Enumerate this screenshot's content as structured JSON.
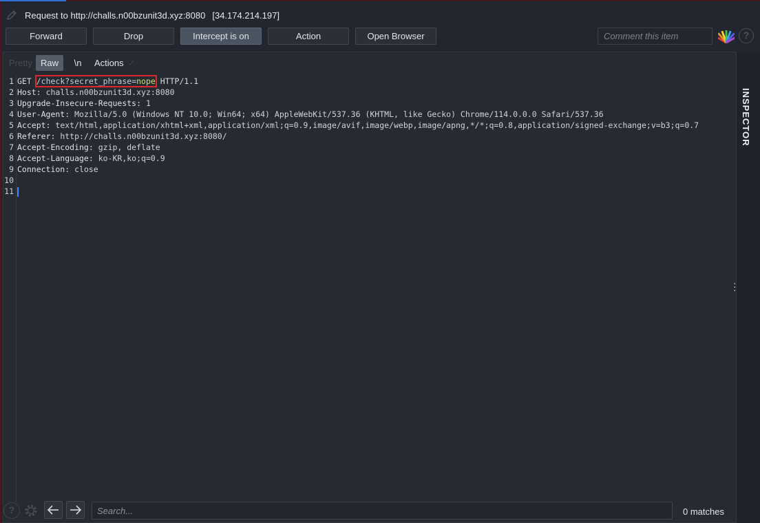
{
  "window": {
    "title_prefix": "Request to",
    "url": "http://challs.n00bzunit3d.xyz:8080",
    "ip": "[34.174.214.197]"
  },
  "toolbar": {
    "forward": "Forward",
    "drop": "Drop",
    "intercept": "Intercept is on",
    "action": "Action",
    "open_browser": "Open Browser",
    "comment_placeholder": "Comment this item"
  },
  "tabs": {
    "pretty": "Pretty",
    "raw": "Raw",
    "newline": "\\n",
    "actions": "Actions",
    "selected": "Raw"
  },
  "request": {
    "line_numbers": [
      "1",
      "2",
      "3",
      "4",
      "5",
      "6",
      "7",
      "8",
      "9",
      "10",
      "11"
    ],
    "method": "GET",
    "path": "/check?secret_phrase=",
    "param_value": "nope",
    "version": "HTTP/1.1",
    "headers": [
      {
        "key": "Host",
        "value": "challs.n00bzunit3d.xyz:8080"
      },
      {
        "key": "Upgrade-Insecure-Requests",
        "value": "1"
      },
      {
        "key": "User-Agent",
        "value": "Mozilla/5.0 (Windows NT 10.0; Win64; x64) AppleWebKit/537.36 (KHTML, like Gecko) Chrome/114.0.0.0 Safari/537.36"
      },
      {
        "key": "Accept",
        "value": "text/html,application/xhtml+xml,application/xml;q=0.9,image/avif,image/webp,image/apng,*/*;q=0.8,application/signed-exchange;v=b3;q=0.7"
      },
      {
        "key": "Referer",
        "value": "http://challs.n00bzunit3d.xyz:8080/"
      },
      {
        "key": "Accept-Encoding",
        "value": "gzip, deflate"
      },
      {
        "key": "Accept-Language",
        "value": "ko-KR,ko;q=0.9"
      },
      {
        "key": "Connection",
        "value": "close"
      }
    ]
  },
  "inspector": {
    "label": "INSPECTOR"
  },
  "search": {
    "placeholder": "Search...",
    "matches": "0 matches"
  },
  "colors": {
    "highlight_box": "#e0262d",
    "param_value": "#c8e07a",
    "caret": "#3d8bff"
  },
  "icons": [
    "pencil-icon",
    "color-fan-icon",
    "help-icon",
    "settings-icon",
    "arrow-left-icon",
    "arrow-right-icon",
    "panel-toggle-icon",
    "more-vertical-icon"
  ]
}
